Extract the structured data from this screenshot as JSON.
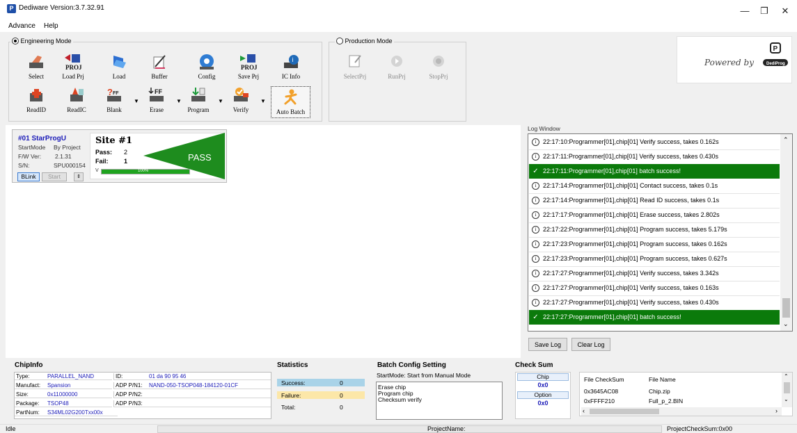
{
  "window": {
    "title": "Dediware Version:3.7.32.91",
    "app_icon_letter": "P",
    "minimize": "—",
    "maximize": "❐",
    "close": "✕"
  },
  "menu": [
    "Advance",
    "Help"
  ],
  "engineering": {
    "label": "Engineering Mode",
    "row1": [
      {
        "name": "select",
        "label": "Select",
        "icon": "hand-chip-icon"
      },
      {
        "name": "load-prj",
        "label": "Load Prj",
        "icon": "proj-load-icon"
      },
      {
        "name": "load",
        "label": "Load",
        "icon": "folder-icon"
      },
      {
        "name": "buffer",
        "label": "Buffer",
        "icon": "notepad-icon"
      },
      {
        "name": "config",
        "label": "Config",
        "icon": "gear-icon"
      },
      {
        "name": "save-prj",
        "label": "Save Prj",
        "icon": "proj-save-icon"
      },
      {
        "name": "ic-info",
        "label": "IC Info",
        "icon": "chip-info-icon"
      }
    ],
    "row2": [
      {
        "name": "readid",
        "label": "ReadID",
        "icon": "readid-icon"
      },
      {
        "name": "readic",
        "label": "ReadIC",
        "icon": "readic-icon"
      },
      {
        "name": "blank",
        "label": "Blank",
        "icon": "blank-icon"
      },
      {
        "name": "erase",
        "label": "Erase",
        "icon": "erase-ff-icon"
      },
      {
        "name": "program",
        "label": "Program",
        "icon": "program-icon"
      },
      {
        "name": "verify",
        "label": "Verify",
        "icon": "verify-icon"
      },
      {
        "name": "auto-batch",
        "label": "Auto Batch",
        "icon": "auto-batch-icon"
      }
    ],
    "proj_text": "PROJ",
    "ff_text": "FF"
  },
  "production": {
    "label": "Production Mode",
    "buttons": [
      {
        "name": "select-prj",
        "label": "SelectPrj"
      },
      {
        "name": "run-prj",
        "label": "RunPrj"
      },
      {
        "name": "stop-prj",
        "label": "StopPrj"
      }
    ]
  },
  "brand": {
    "powered_by": "Powered by",
    "logo": "DediProg"
  },
  "programmer": {
    "name": "#01 StarProgU",
    "startmode_label": "StartMode",
    "startmode": "By Project",
    "fw_label": "F/W Ver:",
    "fw": "2.1.31",
    "sn_label": "S/N:",
    "sn": "SPU000154",
    "blink": "BLink",
    "start": "Start",
    "site": "Site #1",
    "pass_label": "Pass:",
    "pass": "2",
    "fail_label": "Fail:",
    "fail": "1",
    "result": "PASS",
    "v_label": "V",
    "progress_text": "100%",
    "progress": 1.0
  },
  "log": {
    "title": "Log Window",
    "entries": [
      {
        "type": "info",
        "text": "22:17:10:Programmer[01],chip[01] Verify success, takes 0.162s"
      },
      {
        "type": "info",
        "text": "22:17:11:Programmer[01],chip[01] Verify success, takes 0.430s"
      },
      {
        "type": "ok",
        "text": "22:17:11:Programmer[01],chip[01] batch success!"
      },
      {
        "type": "info",
        "text": "22:17:14:Programmer[01],chip[01] Contact success, takes 0.1s"
      },
      {
        "type": "info",
        "text": "22:17:14:Programmer[01],chip[01] Read ID success, takes 0.1s"
      },
      {
        "type": "info",
        "text": "22:17:17:Programmer[01],chip[01] Erase success, takes 2.802s"
      },
      {
        "type": "info",
        "text": "22:17:22:Programmer[01],chip[01] Program success, takes 5.179s"
      },
      {
        "type": "info",
        "text": "22:17:23:Programmer[01],chip[01] Program success, takes 0.162s"
      },
      {
        "type": "info",
        "text": "22:17:23:Programmer[01],chip[01] Program success, takes 0.627s"
      },
      {
        "type": "info",
        "text": "22:17:27:Programmer[01],chip[01] Verify success, takes 3.342s"
      },
      {
        "type": "info",
        "text": "22:17:27:Programmer[01],chip[01] Verify success, takes 0.163s"
      },
      {
        "type": "info",
        "text": "22:17:27:Programmer[01],chip[01] Verify success, takes 0.430s"
      },
      {
        "type": "ok",
        "text": "22:17:27:Programmer[01],chip[01] batch success!"
      }
    ],
    "save": "Save Log",
    "clear": "Clear Log"
  },
  "chipinfo": {
    "title": "ChipInfo",
    "type_label": "Type:",
    "type": "PARALLEL_NAND",
    "manufact_label": "Manufact:",
    "manufact": "Spansion",
    "size_label": "Size:",
    "size": "0x11000000",
    "package_label": "Package:",
    "package": "TSOP48",
    "partnum_label": "PartNum:",
    "partnum": "S34ML02G200Txx00x",
    "id_label": "ID:",
    "id": "01 da 90 95 46",
    "adp1_label": "ADP P/N1:",
    "adp1": "NAND-050-TSOP048-184120-01CF",
    "adp2_label": "ADP P/N2:",
    "adp2": "",
    "adp3_label": "ADP P/N3:",
    "adp3": ""
  },
  "statistics": {
    "title": "Statistics",
    "success_label": "Success:",
    "success": "0",
    "failure_label": "Failure:",
    "failure": "0",
    "total_label": "Total:",
    "total": "0"
  },
  "batch": {
    "title": "Batch Config Setting",
    "startmode": "StartMode:  Start from Manual Mode",
    "steps": [
      "Erase chip",
      "Program chip",
      "Checksum verify"
    ]
  },
  "checksum": {
    "title": "Check Sum",
    "chip_label": "Chip",
    "chip_value": "0x0",
    "option_label": "Option",
    "option_value": "0x0",
    "col1": "File CheckSum",
    "col2": "File Name",
    "rows": [
      {
        "sum": "0x3645AC08",
        "file": "Chip.zip"
      },
      {
        "sum": "0xFFFF210",
        "file": "Full_p_2.BIN"
      }
    ]
  },
  "status": {
    "state": "Idle",
    "project_name_label": "ProjectName:",
    "project_checksum": "ProjectCheckSum:0x00"
  },
  "colors": {
    "pass_green": "#1e8c1e",
    "log_ok": "#0b7a0b",
    "success_bar": "#a9d3e8",
    "failure_bar": "#fce7a8"
  }
}
